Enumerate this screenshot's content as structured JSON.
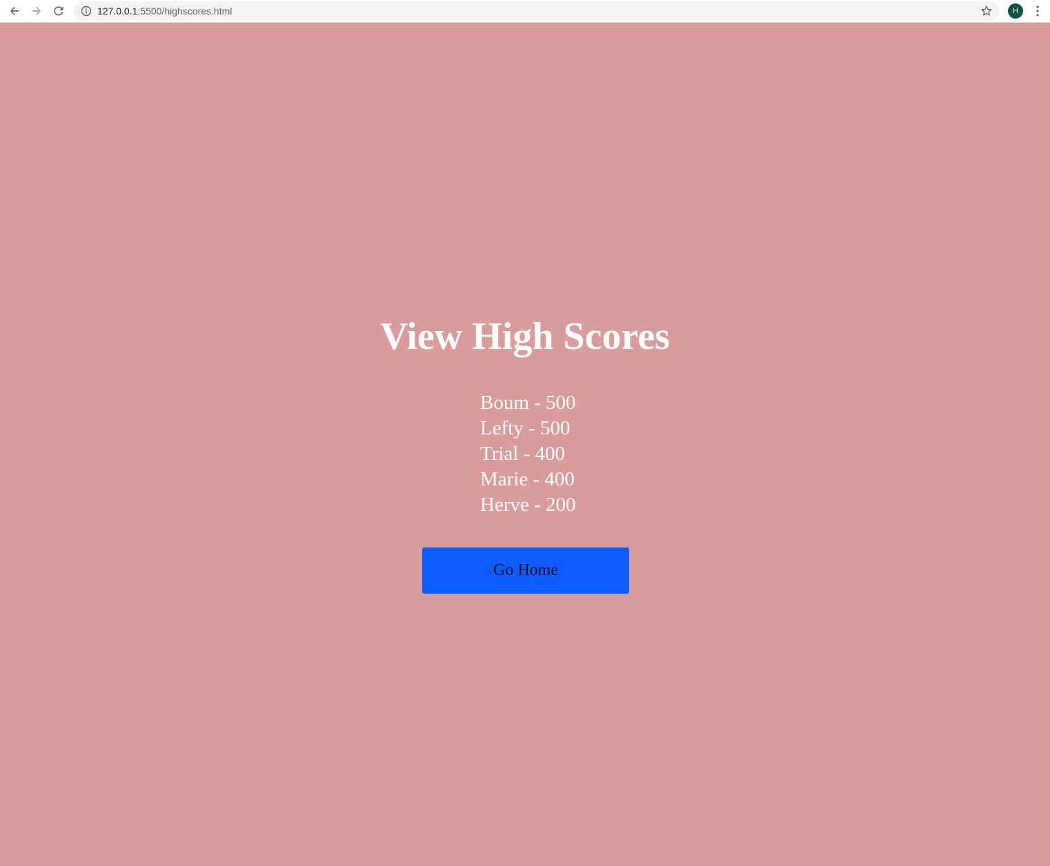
{
  "browser": {
    "url_host": "127.0.0.1",
    "url_path": ":5500/highscores.html",
    "profile_initial": "H",
    "icons": {
      "back": "arrow-left-icon",
      "forward": "arrow-right-icon",
      "reload": "reload-icon",
      "info": "info-icon",
      "bookmark": "star-icon",
      "menu": "kebab-menu-icon"
    }
  },
  "page": {
    "title": "View High Scores",
    "scores": [
      "Boum - 500",
      "Lefty - 500",
      "Trial - 400",
      "Marie - 400",
      "Herve - 200"
    ],
    "home_button_label": "Go Home"
  },
  "colors": {
    "background": "#da9b9b",
    "button": "#0d5cff",
    "text": "#ffffff",
    "avatar": "#0b5345"
  }
}
